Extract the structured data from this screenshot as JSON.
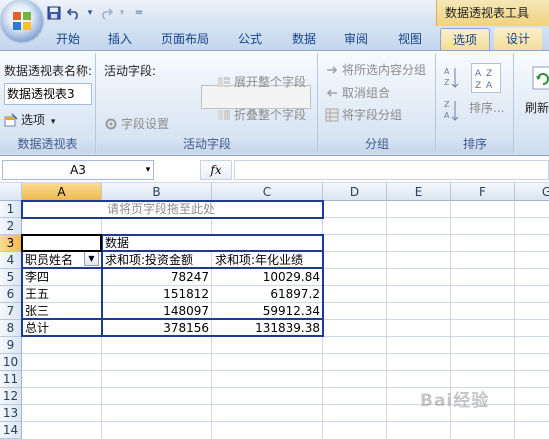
{
  "qat": {
    "undo_arrow": "▾",
    "redo_arrow": "▾",
    "customize": "="
  },
  "context_tab_title": "数据透视表工具",
  "tabs": [
    "开始",
    "插入",
    "页面布局",
    "公式",
    "数据",
    "审阅",
    "视图",
    "选项",
    "设计"
  ],
  "ribbon": {
    "pivot_group": {
      "name_label": "数据透视表名称:",
      "name_value": "数据透视表3",
      "options_label": "选项",
      "options_arrow": "▾",
      "group_label": "数据透视表"
    },
    "active_field_group": {
      "active_field_label": "活动字段:",
      "field_settings": "字段设置",
      "expand_entire_field": "展开整个字段",
      "collapse_entire_field": "折叠整个字段",
      "group_label": "活动字段"
    },
    "group_group": {
      "group_selection": "将所选内容分组",
      "ungroup": "取消组合",
      "group_field": "将字段分组",
      "group_label": "分组"
    },
    "sort_group": {
      "sort": "排序...",
      "group_label": "排序"
    },
    "refresh": {
      "label": "刷新"
    }
  },
  "formula_bar": {
    "name_box": "A3",
    "name_box_arrow": "▾",
    "fx": "fx",
    "formula": ""
  },
  "columns": [
    "A",
    "B",
    "C",
    "D",
    "E",
    "F",
    "G"
  ],
  "rows": [
    "1",
    "2",
    "3",
    "4",
    "5",
    "6",
    "7",
    "8",
    "9",
    "10",
    "11",
    "12",
    "13",
    "14"
  ],
  "cells": {
    "B1": "请将页字段拖至此处",
    "B3": "数据",
    "A4": "职员姓名",
    "B4": "求和项:投资金额",
    "C4": "求和项:年化业绩",
    "A5": "李四",
    "B5": "78247",
    "C5": "10029.84",
    "A6": "王五",
    "B6": "151812",
    "C6": "61897.2",
    "A7": "张三",
    "B7": "148097",
    "C7": "59912.34",
    "A8": "总计",
    "B8": "378156",
    "C8": "131839.38"
  },
  "filter_arrow": "▼",
  "watermark": "Bai经验"
}
